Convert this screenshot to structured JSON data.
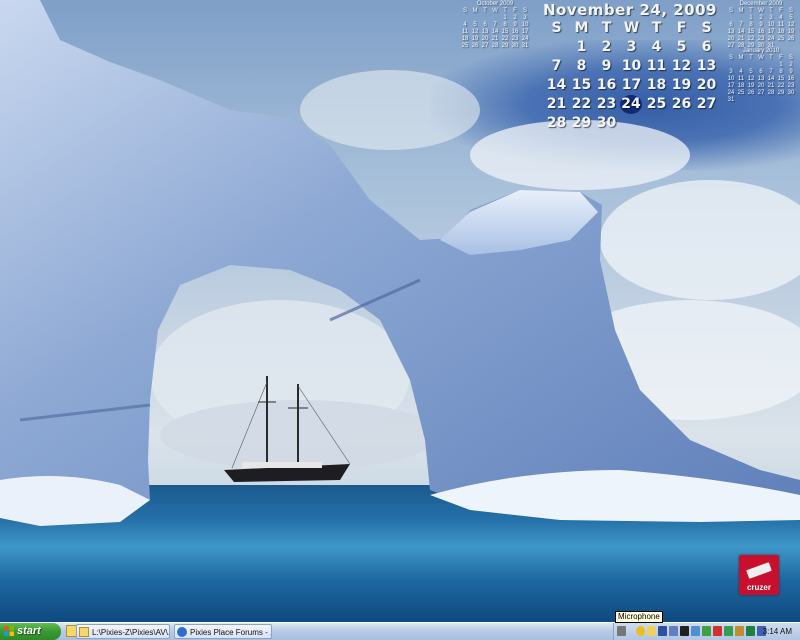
{
  "calendar": {
    "main_title": "November 24, 2009",
    "weekdays": [
      "S",
      "M",
      "T",
      "W",
      "T",
      "F",
      "S"
    ],
    "days": [
      "",
      "1",
      "2",
      "3",
      "4",
      "5",
      "6",
      "7",
      "8",
      "9",
      "10",
      "11",
      "12",
      "13",
      "14",
      "15",
      "16",
      "17",
      "18",
      "19",
      "20",
      "21",
      "22",
      "23",
      "24",
      "25",
      "26",
      "27",
      "28",
      "29",
      "30"
    ],
    "today": "24",
    "prev_month": {
      "title": "October 2009",
      "weekdays": [
        "S",
        "M",
        "T",
        "W",
        "T",
        "F",
        "S"
      ],
      "days": [
        "",
        "",
        "",
        "",
        "1",
        "2",
        "3",
        "4",
        "5",
        "6",
        "7",
        "8",
        "9",
        "10",
        "11",
        "12",
        "13",
        "14",
        "15",
        "16",
        "17",
        "18",
        "19",
        "20",
        "21",
        "22",
        "23",
        "24",
        "25",
        "26",
        "27",
        "28",
        "29",
        "30",
        "31"
      ]
    },
    "next_month": {
      "title": "December 2009",
      "weekdays": [
        "S",
        "M",
        "T",
        "W",
        "T",
        "F",
        "S"
      ],
      "days": [
        "",
        "",
        "1",
        "2",
        "3",
        "4",
        "5",
        "6",
        "7",
        "8",
        "9",
        "10",
        "11",
        "12",
        "13",
        "14",
        "15",
        "16",
        "17",
        "18",
        "19",
        "20",
        "21",
        "22",
        "23",
        "24",
        "25",
        "26",
        "27",
        "28",
        "29",
        "30",
        "31"
      ]
    },
    "next_next_month": {
      "title": "January 2010",
      "weekdays": [
        "S",
        "M",
        "T",
        "W",
        "T",
        "F",
        "S"
      ],
      "days": [
        "",
        "",
        "",
        "",
        "",
        "1",
        "2",
        "3",
        "4",
        "5",
        "6",
        "7",
        "8",
        "9",
        "10",
        "11",
        "12",
        "13",
        "14",
        "15",
        "16",
        "17",
        "18",
        "19",
        "20",
        "21",
        "22",
        "23",
        "24",
        "25",
        "26",
        "27",
        "28",
        "29",
        "30",
        "31"
      ]
    }
  },
  "desktop_logo": {
    "label": "cruzer",
    "color": "#c8102e"
  },
  "tooltip": {
    "text": "Microphone"
  },
  "taskbar": {
    "start_label": "start",
    "quick_launch": [
      {
        "name": "ie-icon"
      },
      {
        "name": "desktop-icon"
      },
      {
        "name": "folder-icon"
      }
    ],
    "tasks": [
      {
        "label": "L:\\Pixies-Z\\Pixies\\AV\\...",
        "icon": "folder-icon"
      },
      {
        "label": "Pixies Place Forums - ...",
        "icon": "ie-icon"
      }
    ],
    "tray_icons": [
      "microphone-icon",
      "shield-icon",
      "mail-icon",
      "network-icon",
      "volume-icon",
      "antivirus-icon",
      "update-icon",
      "usb-icon",
      "display-icon",
      "security-icon",
      "printer-icon",
      "battery-icon",
      "power-icon",
      "chat-icon"
    ],
    "clock": "3:14 AM"
  },
  "colors": {
    "taskbar": "#b9cbe6",
    "start_green": "#3a9a31",
    "today_highlight": "#112a7a"
  }
}
